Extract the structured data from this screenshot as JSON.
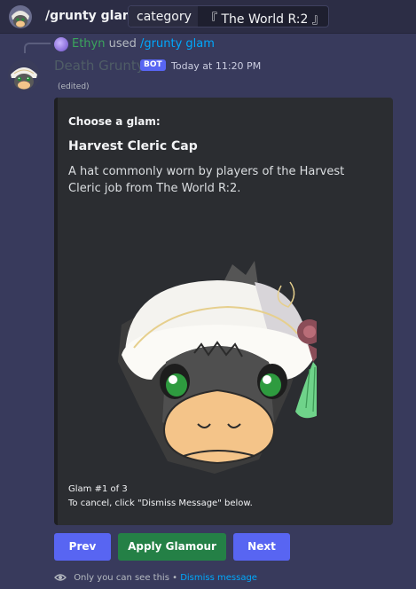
{
  "command_bar": {
    "avatar_icon": "grunty-avatar-icon",
    "command_name": "/grunty glam",
    "option_name": "category",
    "option_value": "『 The World R:2 』"
  },
  "reply": {
    "user": "Ethyn",
    "used_text": "used",
    "command": "/grunty glam"
  },
  "message": {
    "author": "Death Grunty",
    "badge": "BOT",
    "timestamp": "Today at 11:20 PM",
    "edited": "(edited)"
  },
  "embed": {
    "label": "Choose a glam:",
    "title": "Harvest Cleric Cap",
    "description": "A hat commonly worn by players of the Harvest Cleric job from The World R:2.",
    "image_icon": "grunty-harvest-cleric-cap-image",
    "footer_count": "Glam #1 of 3",
    "footer_hint": "To cancel, click \"Dismiss Message\" below."
  },
  "buttons": {
    "prev": "Prev",
    "apply": "Apply Glamour",
    "next": "Next"
  },
  "ephemeral": {
    "notice": "Only you can see this",
    "separator": "•",
    "dismiss": "Dismiss message"
  },
  "colors": {
    "blurple": "#5865f2",
    "green": "#248046",
    "link": "#00a8fc"
  }
}
